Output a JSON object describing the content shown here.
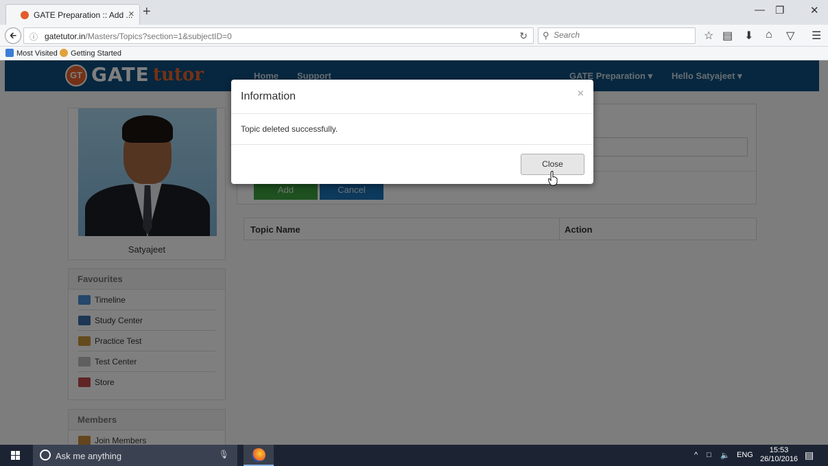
{
  "browser": {
    "tab_title": "GATE Preparation :: Add ...",
    "tab_close": "×",
    "new_tab": "+",
    "url_host": "gatetutor.in",
    "url_path": "/Masters/Topics?section=1&subjectID=0",
    "search_placeholder": "Search",
    "bookmarks": [
      "Most Visited",
      "Getting Started"
    ]
  },
  "site": {
    "logo_gate": "GATE",
    "logo_tutor": "tutor",
    "logo_badge": "GT",
    "nav": {
      "home": "Home",
      "support": "Support",
      "gate_prep": "GATE Preparation ▾",
      "hello": "Hello Satyajeet ▾"
    }
  },
  "profile": {
    "name": "Satyajeet"
  },
  "favourites": {
    "heading": "Favourites",
    "items": [
      "Timeline",
      "Study Center",
      "Practice Test",
      "Test Center",
      "Store"
    ]
  },
  "members": {
    "heading": "Members",
    "items": [
      "Join Members"
    ]
  },
  "form": {
    "add_label": "Add",
    "cancel_label": "Cancel"
  },
  "table": {
    "columns": [
      "Topic Name",
      "Action"
    ]
  },
  "modal": {
    "title": "Information",
    "close_x": "×",
    "message": "Topic deleted successfully.",
    "close_button": "Close"
  },
  "taskbar": {
    "search_text": "Ask me anything",
    "language": "ENG",
    "time": "15:53",
    "date": "26/10/2016"
  },
  "colors": {
    "nav_bg": "#0d4e7f",
    "accent_orange": "#e8632b",
    "add_green": "#3da33f",
    "cancel_blue": "#1873b8"
  }
}
